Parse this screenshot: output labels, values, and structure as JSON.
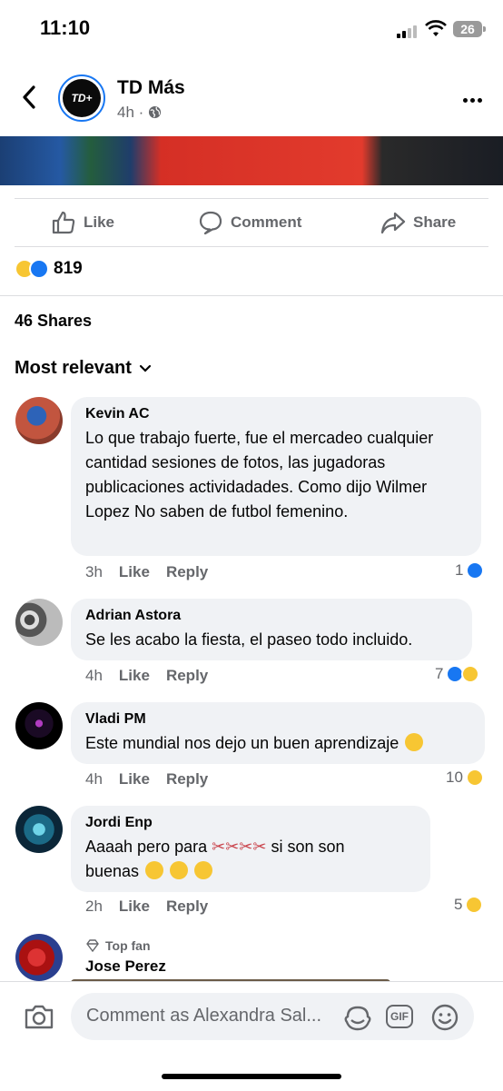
{
  "status": {
    "time": "11:10",
    "battery": "26"
  },
  "header": {
    "page_name": "TD Más",
    "logo_text": "TD+",
    "age": "4h",
    "dot": "·"
  },
  "actions": {
    "like": "Like",
    "comment": "Comment",
    "share": "Share"
  },
  "reactions": {
    "count": "819"
  },
  "shares": "46 Shares",
  "sort": "Most relevant",
  "comments": [
    {
      "name": "Kevin AC",
      "text": "Lo que trabajo fuerte, fue el mercadeo cualquier cantidad sesiones de fotos, las jugadoras publicaciones actividadades. Como dijo Wilmer Lopez No saben de futbol femenino.",
      "time": "3h",
      "like": "Like",
      "reply": "Reply",
      "reactions": "1"
    },
    {
      "name": "Adrian Astora",
      "text": "Se les acabo la fiesta, el paseo todo incluido.",
      "time": "4h",
      "like": "Like",
      "reply": "Reply",
      "reactions": "7"
    },
    {
      "name": "Vladi PM",
      "text": "Este mundial nos dejo un buen aprendizaje",
      "time": "4h",
      "like": "Like",
      "reply": "Reply",
      "reactions": "10"
    },
    {
      "name": "Jordi Enp",
      "text": "Aaaah pero para",
      "text2": "si son son",
      "text3": "buenas",
      "time": "2h",
      "like": "Like",
      "reply": "Reply",
      "reactions": "5"
    },
    {
      "badge": "Top fan",
      "name": "Jose Perez"
    }
  ],
  "composer": {
    "placeholder": "Comment as Alexandra Sal...",
    "gif": "GIF"
  },
  "colors": {
    "accent": "#1877f2",
    "secondary_text": "#65676b",
    "bubble": "#f0f2f5"
  }
}
